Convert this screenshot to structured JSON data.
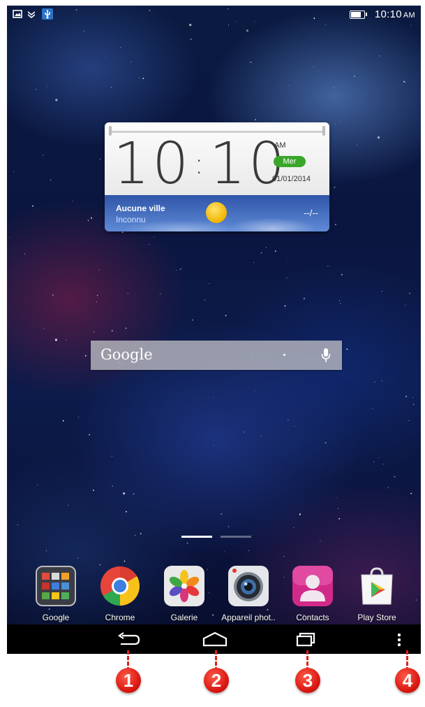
{
  "status_bar": {
    "time": "10:10",
    "ampm": "AM",
    "battery_level": 0.9,
    "notification_icons": [
      "picture-icon",
      "download-icon",
      "usb-icon"
    ]
  },
  "clock_widget": {
    "time": "10:10",
    "ampm": "AM",
    "day": "Mer",
    "date": "01/01/2014",
    "weather": {
      "city": "Aucune ville",
      "status": "Inconnu",
      "temperature": "--/--",
      "icon": "sun-icon"
    }
  },
  "search": {
    "logo": "Google",
    "icon": "mic-icon"
  },
  "page_indicator": {
    "pages": 2,
    "current": 0
  },
  "dock": {
    "apps": [
      {
        "label": "Google",
        "icon": "google-folder-icon"
      },
      {
        "label": "Chrome",
        "icon": "chrome-icon"
      },
      {
        "label": "Galerie",
        "icon": "gallery-icon"
      },
      {
        "label": "Appareil phot..",
        "icon": "camera-icon"
      },
      {
        "label": "Contacts",
        "icon": "contacts-icon"
      },
      {
        "label": "Play Store",
        "icon": "play-store-icon"
      }
    ]
  },
  "nav_bar": {
    "buttons": [
      "back-icon",
      "home-icon",
      "recent-apps-icon",
      "menu-icon"
    ]
  },
  "callouts": [
    "1",
    "2",
    "3",
    "4"
  ],
  "colors": {
    "accent_green": "#3aa72a",
    "callout_red": "#e0211c",
    "weather_blue": "#2f55a8"
  }
}
